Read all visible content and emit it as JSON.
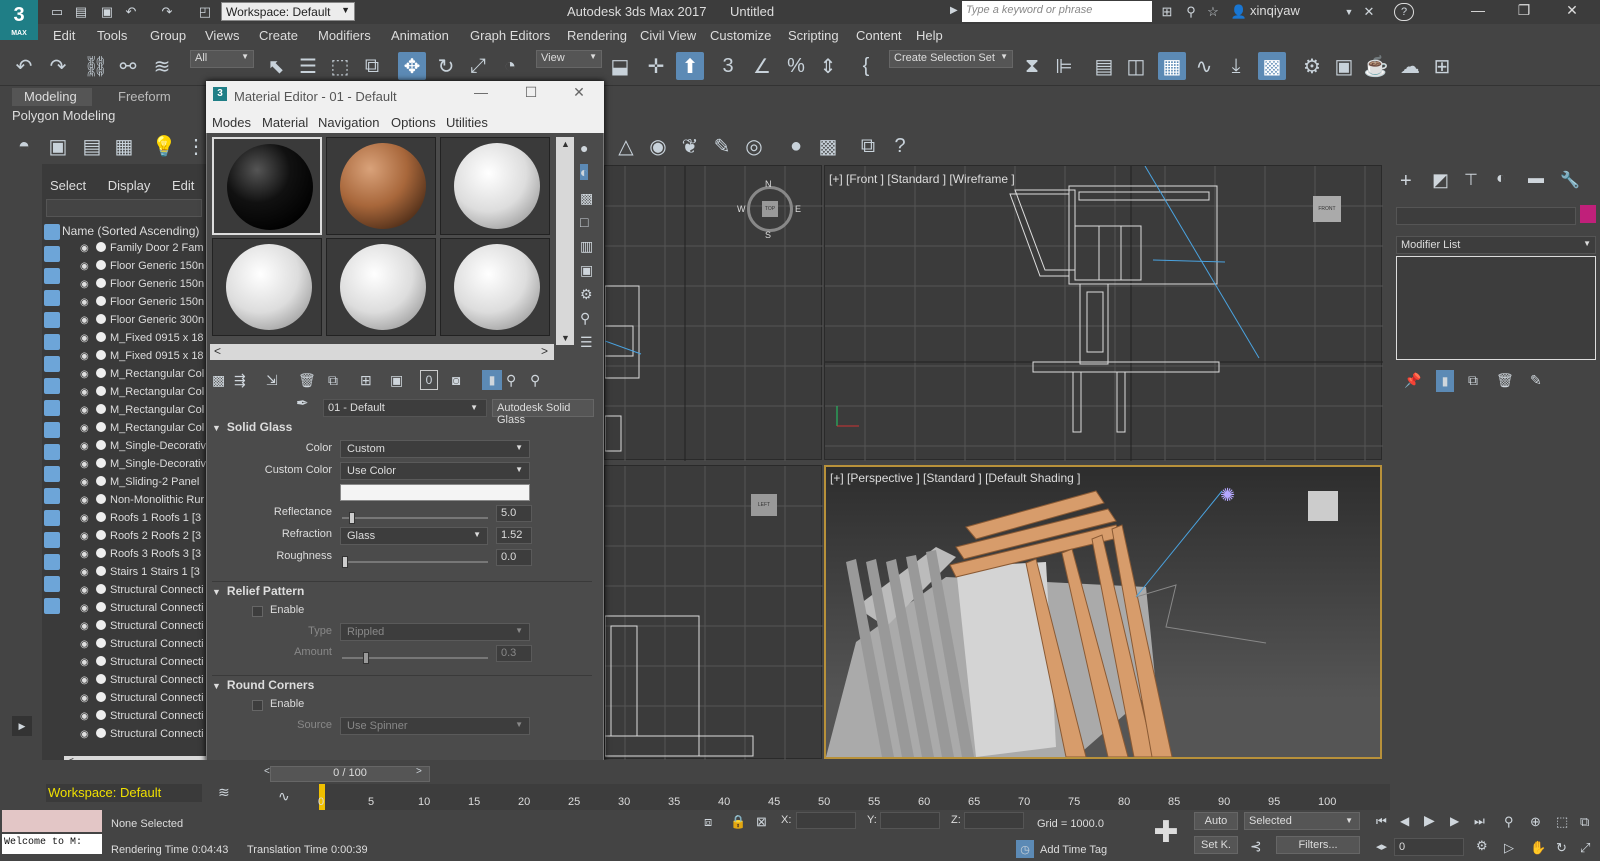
{
  "app": {
    "logo_text": "3",
    "logo_sub": "MAX",
    "title": "Autodesk 3ds Max 2017",
    "document": "Untitled",
    "workspace": "Workspace: Default",
    "search_placeholder": "Type a keyword or phrase",
    "user": "xinqiyaw"
  },
  "menu": [
    "Edit",
    "Tools",
    "Group",
    "Views",
    "Create",
    "Modifiers",
    "Animation",
    "Graph Editors",
    "Rendering",
    "Civil View",
    "Customize",
    "Scripting",
    "Content",
    "Help"
  ],
  "toolbar": {
    "selection_filter": "All",
    "ref_coord": "View",
    "selection_set": "Create Selection Set"
  },
  "ribbon": {
    "tabs": [
      "Modeling",
      "Freeform"
    ],
    "active_tab": "Modeling",
    "panel": "Polygon Modeling"
  },
  "explorer": {
    "tabs": [
      "Select",
      "Display",
      "Edit"
    ],
    "header": "Name (Sorted Ascending)",
    "rows": [
      "Family Door 2 Fam",
      "Floor Generic 150n",
      "Floor Generic 150n",
      "Floor Generic 150n",
      "Floor Generic 300n",
      "M_Fixed 0915 x 18",
      "M_Fixed 0915 x 18",
      "M_Rectangular Col",
      "M_Rectangular Col",
      "M_Rectangular Col",
      "M_Rectangular Col",
      "M_Single-Decorativ",
      "M_Single-Decorativ",
      "M_Sliding-2 Panel",
      "Non-Monolithic Rur",
      "Roofs 1 Roofs 1 [3",
      "Roofs 2 Roofs 2 [3",
      "Roofs 3 Roofs 3 [3",
      "Stairs 1 Stairs 1 [3",
      "Structural Connecti",
      "Structural Connecti",
      "Structural Connecti",
      "Structural Connecti",
      "Structural Connecti",
      "Structural Connecti",
      "Structural Connecti",
      "Structural Connecti",
      "Structural Connecti"
    ]
  },
  "material_editor": {
    "title": "Material Editor - 01 - Default",
    "menu": [
      "Modes",
      "Material",
      "Navigation",
      "Options",
      "Utilities"
    ],
    "material_name": "01 - Default",
    "material_type": "Autodesk Solid Glass",
    "solid_glass": {
      "header": "Solid Glass",
      "color_label": "Color",
      "color_value": "Custom",
      "custom_color_label": "Custom Color",
      "custom_color_value": "Use Color",
      "reflectance_label": "Reflectance",
      "reflectance_value": "5.0",
      "reflectance_level": 0.05,
      "refraction_label": "Refraction",
      "refraction_type": "Glass",
      "refraction_value": "1.52",
      "roughness_label": "Roughness",
      "roughness_value": "0.0",
      "roughness_level": 0.0
    },
    "relief_pattern": {
      "header": "Relief Pattern",
      "enable_label": "Enable",
      "type_label": "Type",
      "type_value": "Rippled",
      "amount_label": "Amount",
      "amount_value": "0.3",
      "amount_level": 0.15
    },
    "round_corners": {
      "header": "Round Corners",
      "enable_label": "Enable",
      "source_label": "Source",
      "source_value": "Use Spinner"
    }
  },
  "viewports": {
    "front": "[+] [Front ] [Standard ] [Wireframe ]",
    "perspective": "[+] [Perspective ] [Standard ] [Default Shading ]",
    "front_cube": "FRONT",
    "top_cube": "TOP",
    "left_cube": "LEFT",
    "compass": [
      "N",
      "E",
      "S",
      "W"
    ]
  },
  "command_panel": {
    "modifier_list": "Modifier List"
  },
  "timeline": {
    "slider": "0 / 100",
    "ticks": [
      "0",
      "5",
      "10",
      "15",
      "20",
      "25",
      "30",
      "35",
      "40",
      "45",
      "50",
      "55",
      "60",
      "65",
      "70",
      "75",
      "80",
      "85",
      "90",
      "95",
      "100"
    ]
  },
  "status": {
    "workspace": "Workspace: Default",
    "listener": "Welcome to M:",
    "selection": "None Selected",
    "render_time": "Rendering Time  0:04:43",
    "translation_time": "Translation Time  0:00:39",
    "x_label": "X:",
    "y_label": "Y:",
    "z_label": "Z:",
    "grid": "Grid = 1000.0",
    "add_time_tag": "Add Time Tag",
    "auto_key": "Auto",
    "set_key": "Set K.",
    "key_filter": "Selected",
    "filters": "Filters...",
    "frame": "0"
  },
  "colors": {
    "accent": "#5c8ab5",
    "highlight": "#b8913a",
    "logo": "#1f7e86",
    "swatch": "#c0207a"
  }
}
